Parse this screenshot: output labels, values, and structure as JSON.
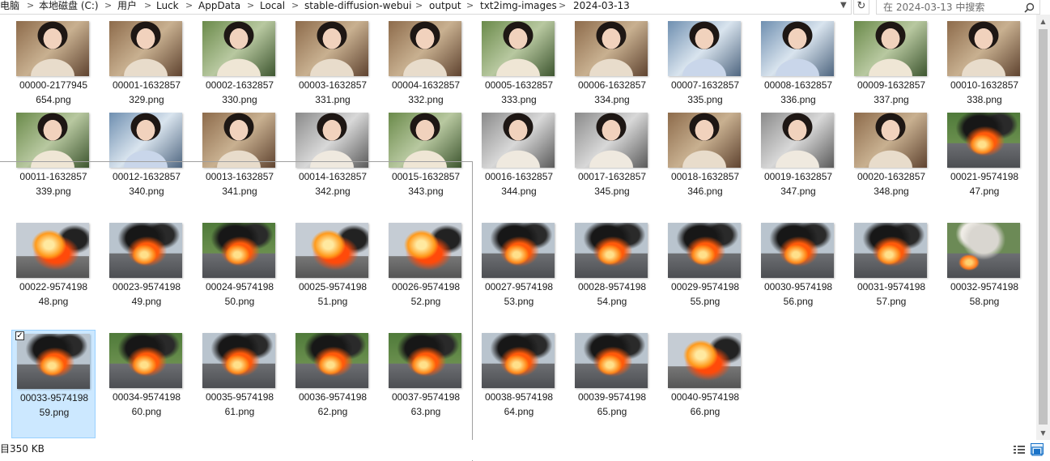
{
  "breadcrumb": {
    "items": [
      "电脑",
      "本地磁盘 (C:)",
      "用户",
      "Luck",
      "AppData",
      "Local",
      "stable-diffusion-webui",
      "output",
      "txt2img-images",
      "2024-03-13"
    ]
  },
  "search": {
    "placeholder": "在 2024-03-13 中搜索"
  },
  "files": [
    {
      "line1": "00000-2177945",
      "line2": "654.png",
      "thumb": "portrait"
    },
    {
      "line1": "00001-1632857",
      "line2": "329.png",
      "thumb": "portrait"
    },
    {
      "line1": "00002-1632857",
      "line2": "330.png",
      "thumb": "portrait green"
    },
    {
      "line1": "00003-1632857",
      "line2": "331.png",
      "thumb": "portrait"
    },
    {
      "line1": "00004-1632857",
      "line2": "332.png",
      "thumb": "portrait"
    },
    {
      "line1": "00005-1632857",
      "line2": "333.png",
      "thumb": "portrait green"
    },
    {
      "line1": "00006-1632857",
      "line2": "334.png",
      "thumb": "portrait"
    },
    {
      "line1": "00007-1632857",
      "line2": "335.png",
      "thumb": "portrait blue"
    },
    {
      "line1": "00008-1632857",
      "line2": "336.png",
      "thumb": "portrait blue"
    },
    {
      "line1": "00009-1632857",
      "line2": "337.png",
      "thumb": "portrait green"
    },
    {
      "line1": "00010-1632857",
      "line2": "338.png",
      "thumb": "portrait"
    },
    {
      "line1": "00011-1632857",
      "line2": "339.png",
      "thumb": "portrait green"
    },
    {
      "line1": "00012-1632857",
      "line2": "340.png",
      "thumb": "portrait blue"
    },
    {
      "line1": "00013-1632857",
      "line2": "341.png",
      "thumb": "portrait"
    },
    {
      "line1": "00014-1632857",
      "line2": "342.png",
      "thumb": "portrait gray"
    },
    {
      "line1": "00015-1632857",
      "line2": "343.png",
      "thumb": "portrait green"
    },
    {
      "line1": "00016-1632857",
      "line2": "344.png",
      "thumb": "portrait gray"
    },
    {
      "line1": "00017-1632857",
      "line2": "345.png",
      "thumb": "portrait gray"
    },
    {
      "line1": "00018-1632857",
      "line2": "346.png",
      "thumb": "portrait"
    },
    {
      "line1": "00019-1632857",
      "line2": "347.png",
      "thumb": "portrait gray"
    },
    {
      "line1": "00020-1632857",
      "line2": "348.png",
      "thumb": "portrait"
    },
    {
      "line1": "00021-9574198",
      "line2": "47.png",
      "thumb": "fire green"
    },
    {
      "line1": "00022-9574198",
      "line2": "48.png",
      "thumb": "fire bright"
    },
    {
      "line1": "00023-9574198",
      "line2": "49.png",
      "thumb": "fire"
    },
    {
      "line1": "00024-9574198",
      "line2": "50.png",
      "thumb": "fire green"
    },
    {
      "line1": "00025-9574198",
      "line2": "51.png",
      "thumb": "fire bright"
    },
    {
      "line1": "00026-9574198",
      "line2": "52.png",
      "thumb": "fire bright"
    },
    {
      "line1": "00027-9574198",
      "line2": "53.png",
      "thumb": "fire"
    },
    {
      "line1": "00028-9574198",
      "line2": "54.png",
      "thumb": "fire"
    },
    {
      "line1": "00029-9574198",
      "line2": "55.png",
      "thumb": "fire"
    },
    {
      "line1": "00030-9574198",
      "line2": "56.png",
      "thumb": "fire"
    },
    {
      "line1": "00031-9574198",
      "line2": "57.png",
      "thumb": "fire"
    },
    {
      "line1": "00032-9574198",
      "line2": "58.png",
      "thumb": "fire smoke"
    },
    {
      "line1": "00033-9574198",
      "line2": "59.png",
      "thumb": "fire",
      "selected": true
    },
    {
      "line1": "00034-9574198",
      "line2": "60.png",
      "thumb": "fire green"
    },
    {
      "line1": "00035-9574198",
      "line2": "61.png",
      "thumb": "fire"
    },
    {
      "line1": "00036-9574198",
      "line2": "62.png",
      "thumb": "fire green"
    },
    {
      "line1": "00037-9574198",
      "line2": "63.png",
      "thumb": "fire green"
    },
    {
      "line1": "00038-9574198",
      "line2": "64.png",
      "thumb": "fire"
    },
    {
      "line1": "00039-9574198",
      "line2": "65.png",
      "thumb": "fire"
    },
    {
      "line1": "00040-9574198",
      "line2": "66.png",
      "thumb": "fire bright"
    }
  ],
  "status": {
    "selection_size": "350 KB",
    "left_fragment": "目"
  },
  "colors": {
    "selection_bg": "#cce8ff",
    "selection_border": "#99d1ff",
    "view_active": "#1a73c8"
  }
}
